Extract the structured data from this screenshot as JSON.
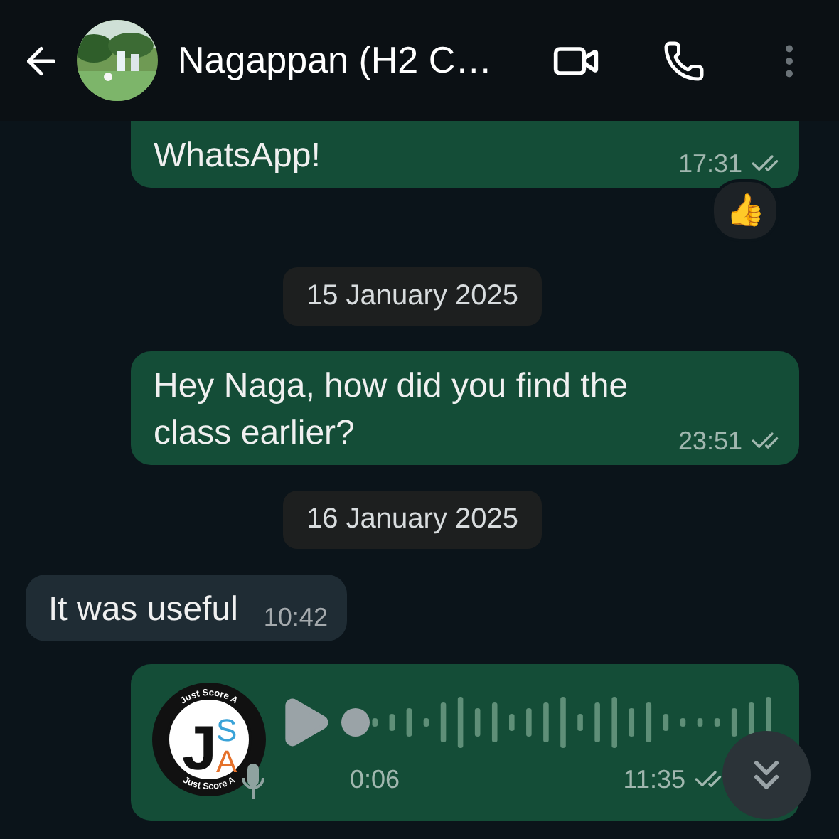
{
  "header": {
    "contact_name": "Nagappan (H2 C…"
  },
  "messages": [
    {
      "kind": "text",
      "outgoing": true,
      "text": "WhatsApp!",
      "time": "17:31",
      "read": false,
      "reaction": "👍"
    },
    {
      "kind": "date",
      "text": "15 January 2025"
    },
    {
      "kind": "text",
      "outgoing": true,
      "text": "Hey Naga, how did you find the class earlier?",
      "time": "23:51",
      "read": false
    },
    {
      "kind": "date",
      "text": "16 January 2025"
    },
    {
      "kind": "text",
      "outgoing": false,
      "text": "It was useful",
      "time": "10:42"
    },
    {
      "kind": "voice",
      "outgoing": true,
      "duration": "0:06",
      "time": "11:35",
      "read": false,
      "sender_logo": {
        "ring_text_top": "Just Score A",
        "ring_text_bottom": "Just Score A",
        "monogram": [
          "J",
          "S",
          "A"
        ]
      }
    }
  ]
}
